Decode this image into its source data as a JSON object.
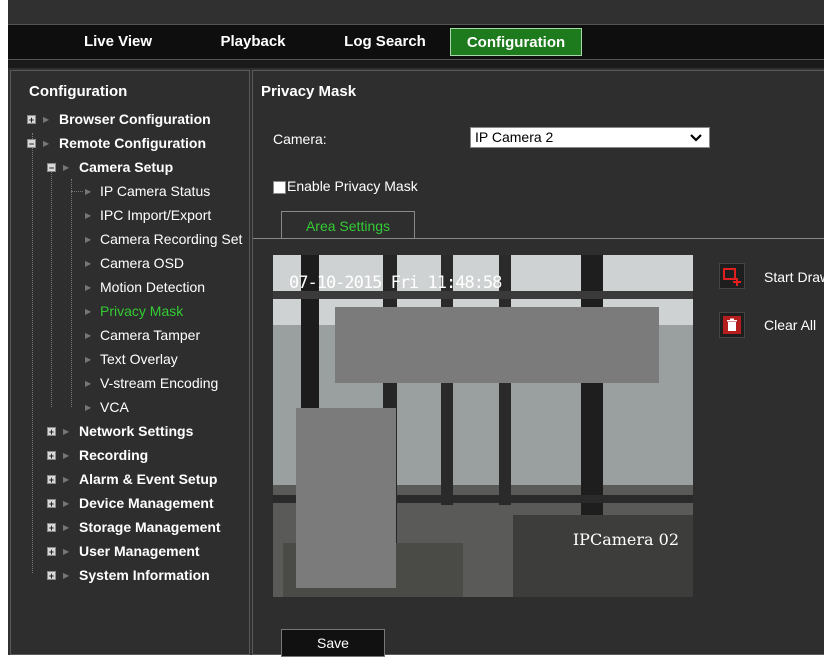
{
  "nav": {
    "tabs": [
      {
        "label": "Live View"
      },
      {
        "label": "Playback"
      },
      {
        "label": "Log Search"
      },
      {
        "label": "Configuration"
      }
    ]
  },
  "sidebar": {
    "title": "Configuration",
    "items": [
      {
        "label": "Browser Configuration"
      },
      {
        "label": "Remote Configuration"
      },
      {
        "label": "Camera Setup"
      },
      {
        "label": "IP Camera Status"
      },
      {
        "label": "IPC Import/Export"
      },
      {
        "label": "Camera Recording Set"
      },
      {
        "label": "Camera OSD"
      },
      {
        "label": "Motion Detection"
      },
      {
        "label": "Privacy Mask"
      },
      {
        "label": "Camera Tamper"
      },
      {
        "label": "Text Overlay"
      },
      {
        "label": "V-stream Encoding"
      },
      {
        "label": "VCA"
      },
      {
        "label": "Network Settings"
      },
      {
        "label": "Recording"
      },
      {
        "label": "Alarm & Event Setup"
      },
      {
        "label": "Device Management"
      },
      {
        "label": "Storage Management"
      },
      {
        "label": "User Management"
      },
      {
        "label": "System Information"
      }
    ]
  },
  "main": {
    "title": "Privacy Mask",
    "camera_label": "Camera:",
    "camera_value": "IP Camera 2",
    "enable_label": "Enable Privacy Mask",
    "enable_checked": false,
    "area_tab": "Area Settings",
    "osd_time": "07-10-2015 Fri 11:48:58",
    "osd_name": "IPCamera 02",
    "start_draw": "Start Draw",
    "clear_all": "Clear All",
    "save": "Save"
  },
  "colors": {
    "accent_green": "#33cc33",
    "active_tab_bg": "#1d7a1d",
    "tool_red": "#cc2222"
  },
  "icons": {
    "start_draw": "draw-rectangle-icon",
    "clear_all": "trash-icon",
    "dropdown": "chevron-down-icon"
  }
}
